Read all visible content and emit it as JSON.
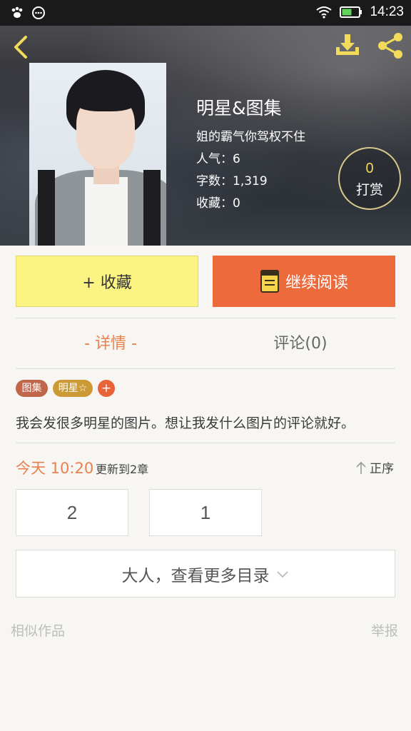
{
  "status_bar": {
    "time": "14:23",
    "icons": [
      "paw-icon",
      "message-icon",
      "wifi-icon",
      "battery-icon"
    ]
  },
  "header": {
    "book": {
      "title": "明星&图集",
      "author": "姐的霸气你驾权不住",
      "popularity": "人气：6",
      "word_count": "字数：1,319",
      "favorites": "收藏：0"
    },
    "tip": {
      "count": "0",
      "label": "打赏"
    },
    "icons": [
      "back-arrow-icon",
      "download-icon",
      "share-icon"
    ]
  },
  "actions": {
    "favorite_label": "+ 收藏",
    "continue_label": "继续阅读",
    "colors": {
      "favorite_bg": "#fbf483",
      "continue_bg": "#ec6a3c"
    }
  },
  "tabs": {
    "detail": "- 详情 -",
    "comments": "评论(0)"
  },
  "tags": {
    "tag1": "图集",
    "tag2": "明星☆",
    "add": "+"
  },
  "description": "我会发很多明星的图片。想让我发什么图片的评论就好。",
  "update": {
    "time": "今天 10:20",
    "text": "更新到2章",
    "order": "正序"
  },
  "chapters": [
    "2",
    "1"
  ],
  "more_toc": "大人，查看更多目录",
  "footer": {
    "similar": "相似作品",
    "report": "举报"
  },
  "accent_color": "#e9814e"
}
